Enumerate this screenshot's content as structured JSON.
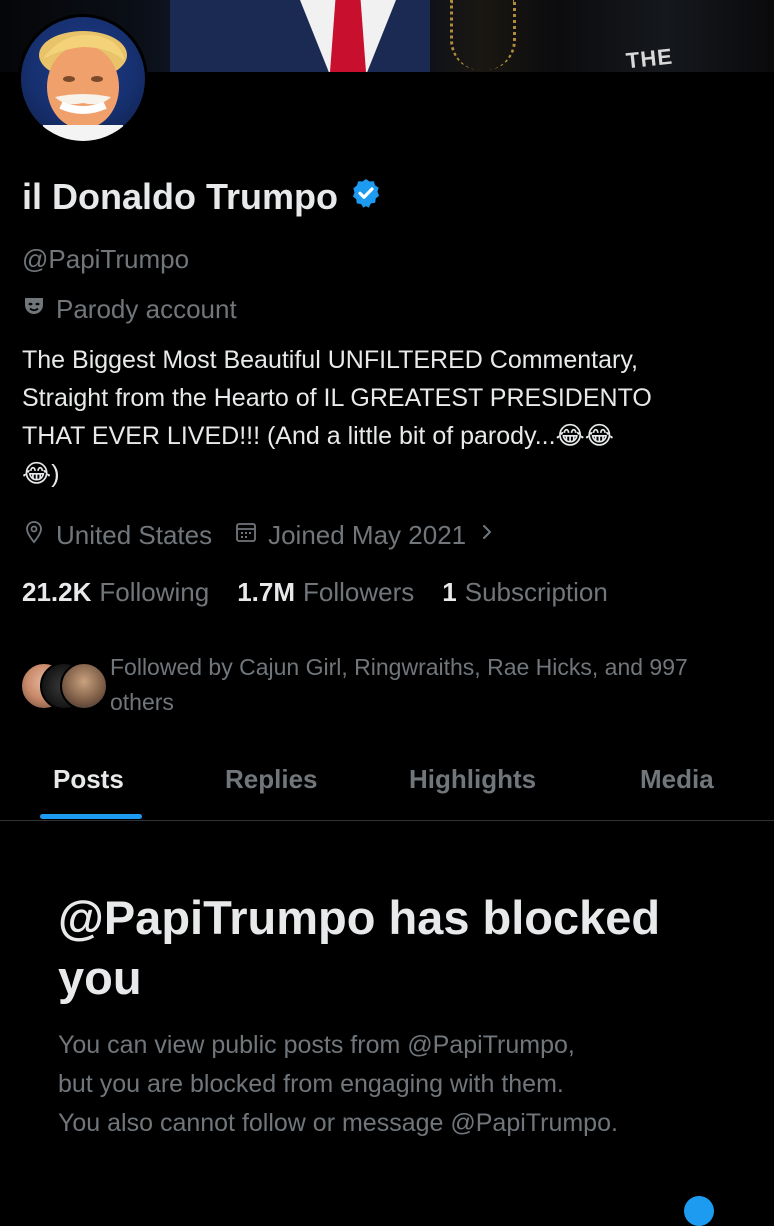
{
  "profile": {
    "name": "il Donaldo Trumpo",
    "handle": "@PapiTrumpo",
    "parody_label": "Parody account",
    "bio": "The Biggest Most Beautiful UNFILTERED Commentary,\nStraight from the Hearto of IL GREATEST PRESIDENTO\nTHAT EVER LIVED!!! (And a little bit of parody...😂😂\n😂)",
    "location": "United States",
    "joined": "Joined May 2021"
  },
  "banner": {
    "lettering": "THE"
  },
  "stats": [
    {
      "value": "21.2K",
      "label": "Following"
    },
    {
      "value": "1.7M",
      "label": "Followers"
    },
    {
      "value": "1",
      "label": "Subscription"
    }
  ],
  "followed_by": "Followed by Cajun Girl, Ringwraiths, Rae Hicks, and 997 others",
  "tabs": [
    {
      "label": "Posts",
      "active": true
    },
    {
      "label": "Replies",
      "active": false
    },
    {
      "label": "Highlights",
      "active": false
    },
    {
      "label": "Media",
      "active": false
    }
  ],
  "blocked": {
    "title": "@PapiTrumpo has blocked you",
    "description": "You can view public posts from @PapiTrumpo,\nbut you are blocked from engaging with them.\nYou also cannot follow or message @PapiTrumpo."
  },
  "icons": {
    "verified": "verified-badge-icon",
    "parody": "theater-mask-icon",
    "location": "location-pin-icon",
    "calendar": "calendar-icon",
    "chevron": "chevron-right-icon"
  },
  "colors": {
    "background": "#000000",
    "text_primary": "#e7e9ea",
    "text_secondary": "#71767b",
    "accent": "#1d9bf0",
    "divider": "#2f3336"
  }
}
